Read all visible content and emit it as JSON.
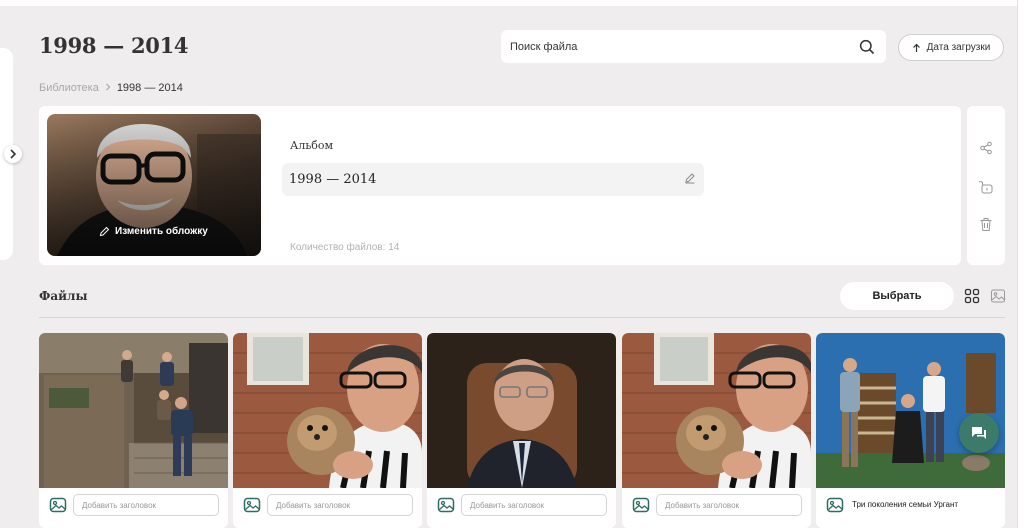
{
  "header": {
    "title": "1998 — 2014",
    "search_placeholder": "Поиск файла",
    "date_button_label": "Дата загрузки"
  },
  "breadcrumb": {
    "library": "Библиотека",
    "separator": ">",
    "current": "1998 — 2014"
  },
  "album": {
    "change_cover_label": "Изменить обложку",
    "label": "Альбом",
    "name": "1998 — 2014",
    "file_count_text": "Количество файлов: 14"
  },
  "side_actions": [
    "share-icon",
    "unlock-icon",
    "trash-icon"
  ],
  "files": {
    "title": "Файлы",
    "select_label": "Выбрать",
    "caption_placeholder": "Добавить заголовок",
    "items": [
      {
        "caption": ""
      },
      {
        "caption": ""
      },
      {
        "caption": ""
      },
      {
        "caption": ""
      },
      {
        "caption": "Три поколения семьи Ургант"
      }
    ]
  },
  "colors": {
    "background": "#efedee",
    "accent_green": "#3c7a6a",
    "card": "#ffffff"
  }
}
